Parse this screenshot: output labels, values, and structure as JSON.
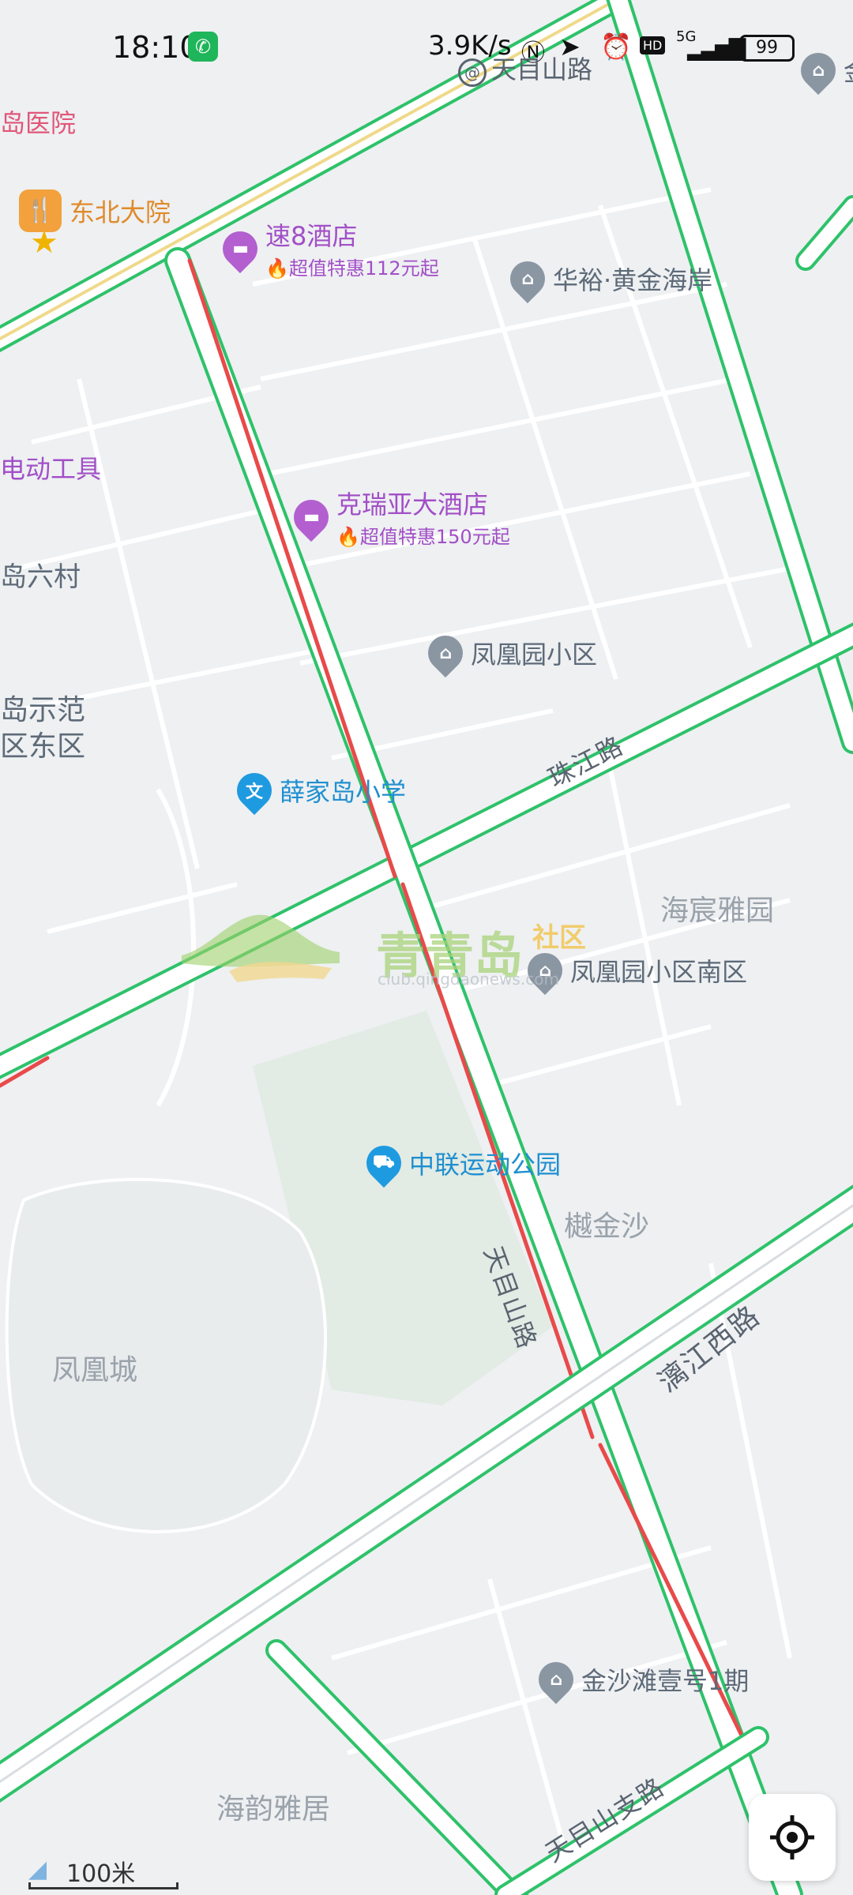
{
  "status_bar": {
    "time": "18:10",
    "network_speed": "3.9K/s",
    "signal": "5G",
    "battery": "99"
  },
  "pois": [
    {
      "name": "速8酒店",
      "deal": "超值特惠112元起",
      "kind": "hotel"
    },
    {
      "name": "克瑞亚大酒店",
      "deal": "超值特惠150元起",
      "kind": "hotel"
    },
    {
      "name": "华裕·黄金海岸",
      "kind": "residential"
    },
    {
      "name": "凤凰园小区",
      "kind": "residential"
    },
    {
      "name": "薛家岛小学",
      "kind": "school"
    },
    {
      "name": "凤凰园小区南区",
      "kind": "residential"
    },
    {
      "name": "中联运动公园",
      "kind": "park"
    },
    {
      "name": "金沙滩壹号1期",
      "kind": "residential"
    },
    {
      "name": "东北大院",
      "kind": "restaurant"
    }
  ],
  "area_labels": [
    "海宸雅园",
    "樾金沙",
    "凤凰城",
    "海韵雅居"
  ],
  "edge_labels": [
    "岛医院",
    "电动工具",
    "岛六村",
    "岛示范",
    "区东区",
    "金"
  ],
  "roads": {
    "tianmushan_top": "天目山路",
    "zhujiang": "珠江路",
    "tianmushan": "天目山路",
    "lijiang_west": "漓江西路",
    "tianmushan_branch": "天目山支路"
  },
  "watermark": {
    "title": "青青岛",
    "suffix": "社区",
    "url": "club.qingdaonews.com"
  },
  "scale": "100米",
  "icons": {
    "phone": "phone-icon",
    "locate": "locate-icon",
    "brand": "map-brand-logo"
  },
  "colors": {
    "road_green": "#2ec26a",
    "road_red": "#e84a4a",
    "road_fill": "#ffffff",
    "hotel": "#b35fd0",
    "school": "#1e9ae0"
  }
}
